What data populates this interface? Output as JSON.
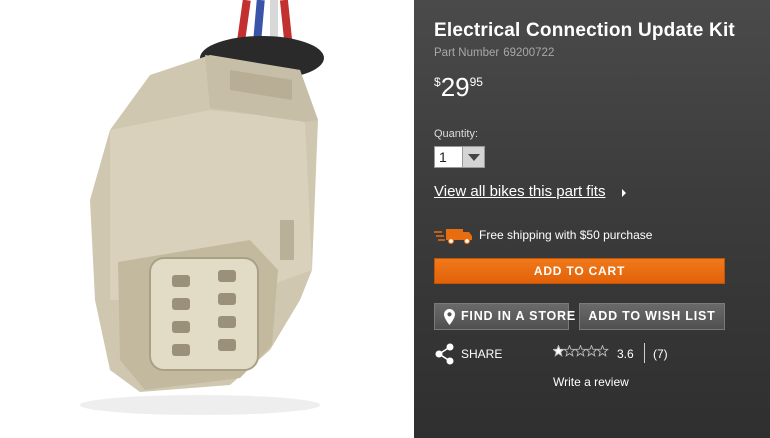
{
  "product": {
    "title": "Electrical Connection Update Kit",
    "part_number_label": "Part Number",
    "part_number": "69200722"
  },
  "price": {
    "currency": "$",
    "whole": "29",
    "cents": "95"
  },
  "quantity": {
    "label": "Quantity:",
    "value": "1"
  },
  "links": {
    "view_fits": "View all bikes this part fits"
  },
  "shipping": {
    "text": "Free shipping with $50 purchase"
  },
  "buttons": {
    "add_to_cart": "ADD TO CART",
    "find_in_store": "FIND IN A STORE",
    "add_to_wish_list": "ADD TO WISH LIST"
  },
  "social": {
    "share_label": "SHARE"
  },
  "reviews": {
    "rating": "3.6",
    "rating_value": 3.6,
    "rating_max": 5,
    "count": "(7)",
    "write_review": "Write a review"
  },
  "colors": {
    "accent_orange": "#e86d10",
    "panel_dark": "#3c3c3c",
    "part_number_gray": "#a8a8a8"
  },
  "icons": [
    "map-pin-icon",
    "share-icon",
    "shipping-truck-icon",
    "star-icon",
    "dropdown-arrow-icon",
    "chevron-right-icon"
  ]
}
